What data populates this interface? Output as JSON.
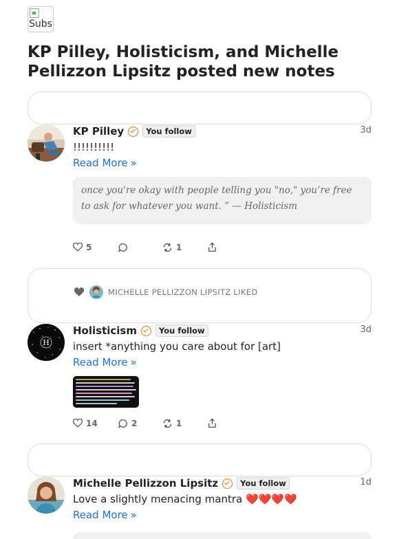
{
  "header": {
    "logo_alt": "Subs",
    "title": "KP Pilley, Holisticism, and Michelle Pellizzon Lipsitz posted new notes"
  },
  "notes": [
    {
      "author": "KP Pilley",
      "badge": "You follow",
      "time": "3d",
      "text": "!!!!!!!!!!",
      "read_more": "Read More",
      "quote": "once you're okay with people telling you \"no,\" you’re free to ask for whatever you want. ” — Holisticism",
      "likes": "5",
      "comments": "",
      "restacks": "1"
    },
    {
      "liked_by": "MICHELLE PELLIZZON LIPSITZ LIKED",
      "author": "Holisticism",
      "badge": "You follow",
      "time": "3d",
      "text": "insert *anything you care about for [art]",
      "read_more": "Read More",
      "likes": "14",
      "comments": "2",
      "restacks": "1"
    },
    {
      "author": "Michelle Pellizzon Lipsitz",
      "badge": "You follow",
      "time": "1d",
      "text": "Love a slightly menacing mantra ❤️❤️❤️❤️",
      "read_more": "Read More"
    }
  ],
  "icons": {
    "verified": "check-circle-icon",
    "like": "heart-icon",
    "comment": "speech-bubble-icon",
    "restack": "restack-arrows-icon",
    "share": "share-icon",
    "read_more": "double-chevron-right-icon"
  },
  "colors": {
    "accent": "#e8751a",
    "link": "#1a73e8"
  }
}
